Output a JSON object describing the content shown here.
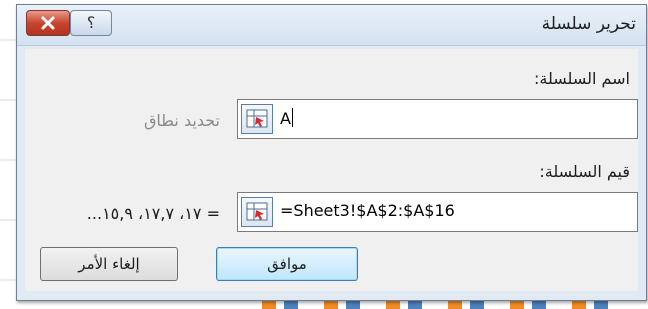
{
  "dialog": {
    "title": "تحرير سلسلة",
    "help_glyph": "؟",
    "series_name": {
      "label": "اسم السلسلة:",
      "value": "A",
      "preview": "تحديد نطاق"
    },
    "series_values": {
      "label": "قيم السلسلة:",
      "value": "=Sheet3!$A$2:$A$16",
      "preview": "= ١٧، ١٧,٧، ١٥,٩..."
    },
    "buttons": {
      "ok": "موافق",
      "cancel": "إلغاء الأمر"
    }
  },
  "colors": {
    "close_button": "#c9452f",
    "ok_border": "#3c7fb1",
    "chart_bar_a": "#f08a24",
    "chart_bar_b": "#4f81bd"
  }
}
